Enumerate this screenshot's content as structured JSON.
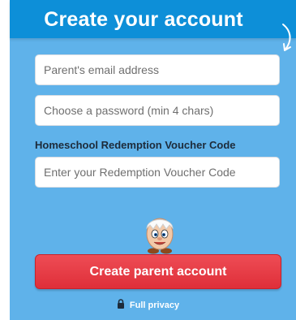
{
  "header": {
    "title": "Create your account"
  },
  "form": {
    "email_placeholder": "Parent's email address",
    "password_placeholder": "Choose a password (min 4 chars)",
    "voucher_label": "Homeschool Redemption Voucher Code",
    "voucher_placeholder": "Enter your Redemption Voucher Code",
    "submit_label": "Create parent account"
  },
  "footer": {
    "privacy_text": "Full privacy"
  },
  "icons": {
    "mascot": "egg-character-icon",
    "privacy": "lock-icon",
    "decoration": "squiggle-icon"
  },
  "colors": {
    "panel_bg": "#5fb2ea",
    "header_bg": "#0d8fd8",
    "button_red": "#e63b44"
  }
}
